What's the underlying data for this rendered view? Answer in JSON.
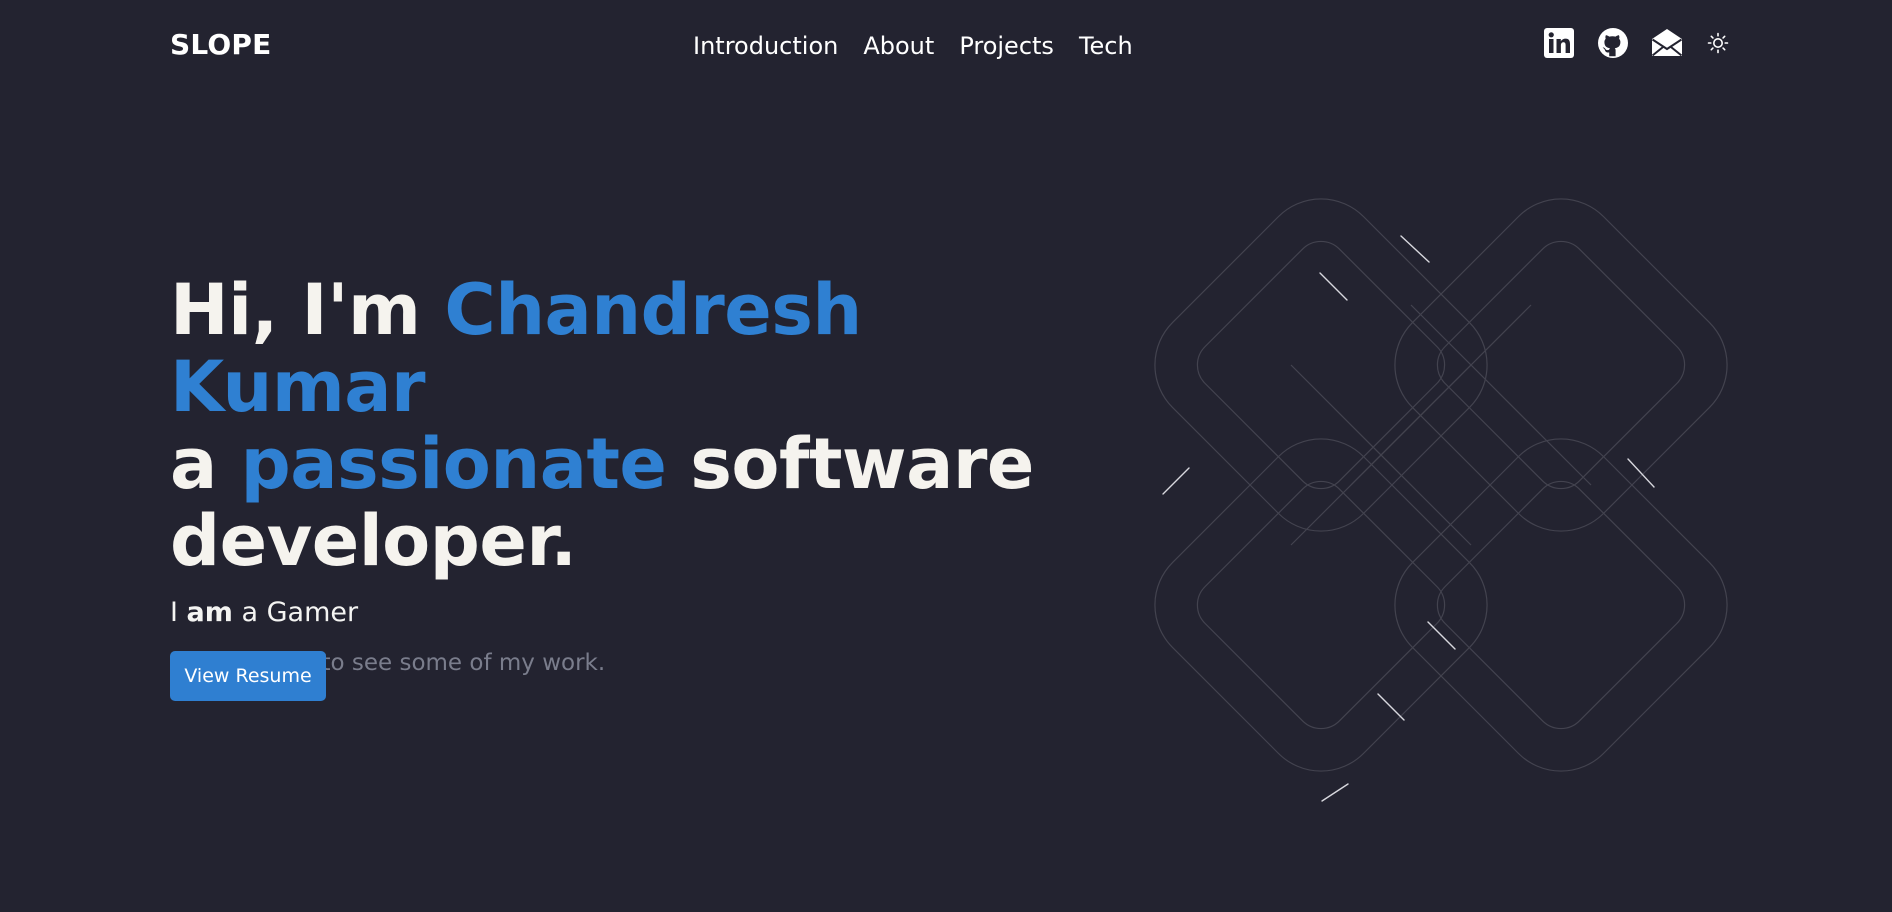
{
  "header": {
    "logo": "SLOPE",
    "nav": [
      "Introduction",
      "About",
      "Projects",
      "Tech"
    ],
    "social_icons": [
      "linkedin-icon",
      "github-icon",
      "mail-icon",
      "sun-icon"
    ]
  },
  "hero": {
    "greeting": "Hi, I'm ",
    "name": "Chandresh Kumar",
    "line2_a": "a ",
    "line2_accent": "passionate",
    "line2_b": " software",
    "line3": "developer.",
    "role_prefix": "I ",
    "role_bold": "am",
    "role_suffix": " a Gamer",
    "tagline": "Stick around to see some of my work.",
    "cta": "View Resume"
  },
  "colors": {
    "background": "#232330",
    "accent": "#2f80d2",
    "text": "#f5f3ee",
    "muted": "#7a7d8c"
  }
}
